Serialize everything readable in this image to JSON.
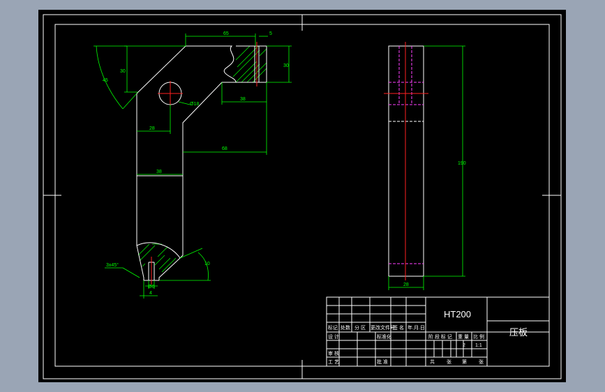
{
  "drawing": {
    "dimensions": {
      "d65": "65",
      "d5": "5",
      "d30a": "30",
      "d30b": "30",
      "d45": "45",
      "phi18": "Ø18",
      "d38a": "38",
      "d28a": "28",
      "d68": "68",
      "d38b": "38",
      "chamfer": "3x45°",
      "d10": "10",
      "phi6": "Ø6",
      "d4": "4",
      "d190": "190",
      "d28b": "28"
    }
  },
  "title_block": {
    "material": "HT200",
    "part_name": "压板",
    "row_labels": [
      "标记",
      "处数",
      "分 区",
      "更改文件号",
      "签 名",
      "年.月.日"
    ],
    "design": "设 计",
    "standardize": "标准化",
    "review": "审 核",
    "process": "工 艺",
    "approve": "批 准",
    "stage_row": [
      "阶 段 标 记",
      "重 量",
      "比 例"
    ],
    "quantity": "2",
    "scale": "1:1",
    "sheet_row": [
      "共",
      "张",
      "第",
      "张"
    ]
  },
  "colors": {
    "background": "#000000",
    "outline": "#ffffff",
    "dimension": "#00ff00",
    "centerline": "#ff2020",
    "hidden": "#ff40ff"
  }
}
